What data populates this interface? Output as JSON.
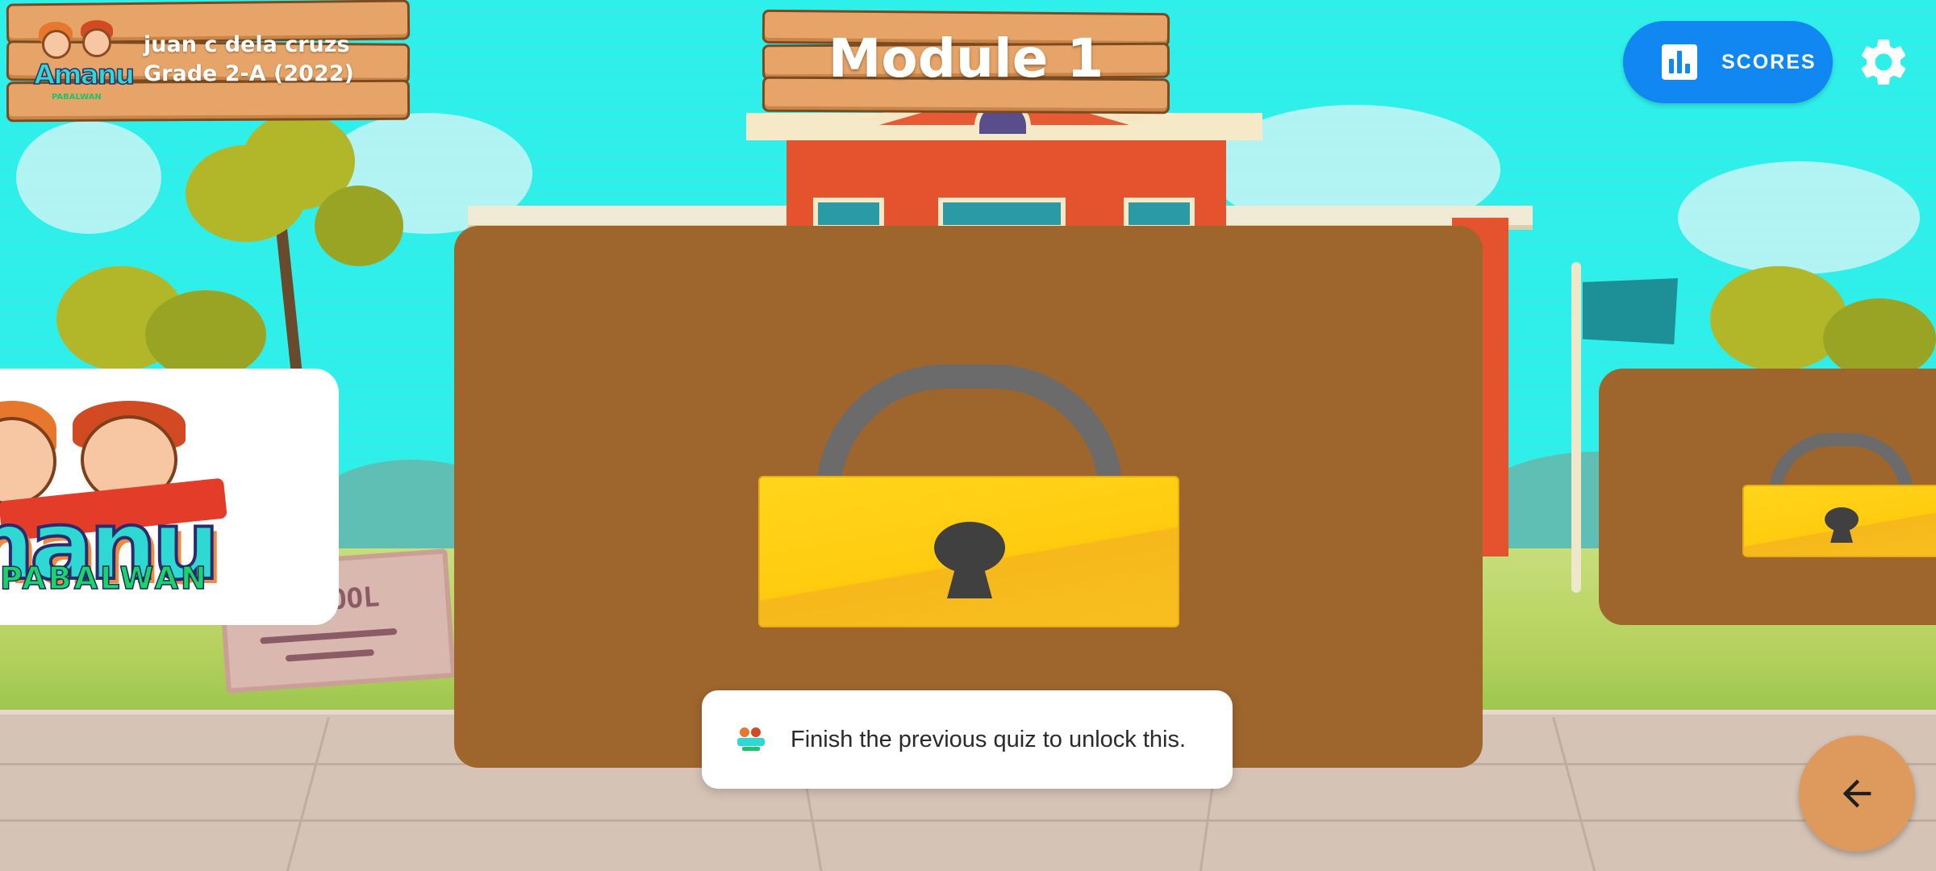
{
  "user": {
    "name": "juan c dela cruzs",
    "grade": "Grade 2-A (2022)",
    "logo_text": "Amanu",
    "logo_subtext": "PABALWAN"
  },
  "header": {
    "title": "Module 1"
  },
  "toolbar": {
    "scores_label": "SCORES",
    "scores_icon": "bar-chart-icon",
    "settings_icon": "gear-icon"
  },
  "carousel": {
    "previous_card": {
      "logo_text": "manu",
      "logo_subtext": "PABALWAN",
      "state": "unlocked"
    },
    "current_card": {
      "icon": "padlock-icon",
      "state": "locked"
    },
    "next_card": {
      "icon": "padlock-icon",
      "state": "locked"
    }
  },
  "background": {
    "sign_text": "OOL"
  },
  "toast": {
    "message": "Finish the previous quiz to unlock this.",
    "icon": "app-logo-icon"
  },
  "navigation": {
    "back_icon": "arrow-left-icon"
  },
  "colors": {
    "sky": "#2ef0ea",
    "wood": "#e6a468",
    "card": "#9e652d",
    "scores_button": "#1187f2",
    "padlock": "#ffcb0e",
    "back_button": "#dd9a5c"
  }
}
